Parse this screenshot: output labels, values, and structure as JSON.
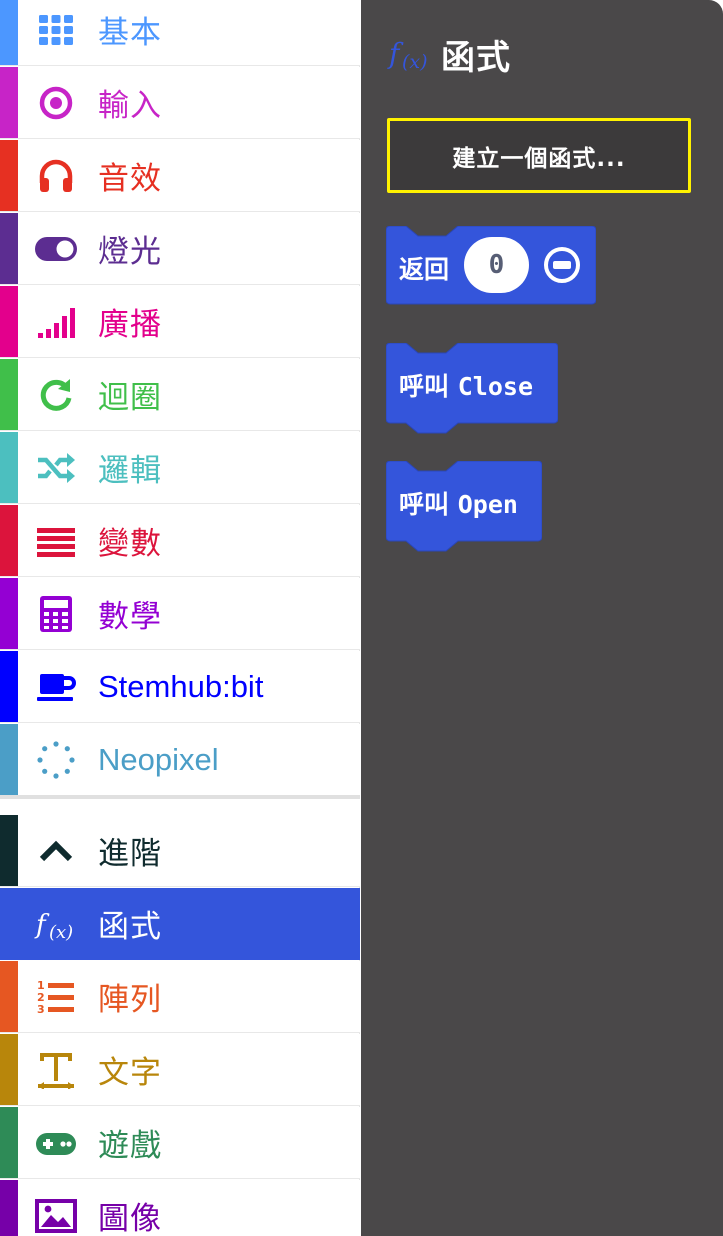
{
  "toolbox": {
    "categories": [
      {
        "label": "基本",
        "color": "#4c97ff",
        "icon": "grid-icon"
      },
      {
        "label": "輸入",
        "color": "#c724c7",
        "icon": "target-icon"
      },
      {
        "label": "音效",
        "color": "#e63022",
        "icon": "headphones-icon"
      },
      {
        "label": "燈光",
        "color": "#5c2d91",
        "icon": "toggle-icon"
      },
      {
        "label": "廣播",
        "color": "#e3008c",
        "icon": "signal-bars-icon"
      },
      {
        "label": "迴圈",
        "color": "#40bf4a",
        "icon": "refresh-icon"
      },
      {
        "label": "邏輯",
        "color": "#4cbfbf",
        "icon": "shuffle-icon"
      },
      {
        "label": "變數",
        "color": "#dc143c",
        "icon": "list-lines-icon"
      },
      {
        "label": "數學",
        "color": "#9400d3",
        "icon": "calculator-icon"
      },
      {
        "label": "Stemhub:bit",
        "color": "#0000ff",
        "icon": "coffee-cup-icon"
      },
      {
        "label": "Neopixel",
        "color": "#4b9ec7",
        "icon": "dotted-circle-icon"
      }
    ],
    "advanced": [
      {
        "label": "進階",
        "color": "#0f2b2e",
        "icon": "chevron-up-icon"
      },
      {
        "label": "函式",
        "color": "#3455db",
        "icon": "function-icon",
        "selected": true
      },
      {
        "label": "陣列",
        "color": "#e65722",
        "icon": "numbered-list-icon"
      },
      {
        "label": "文字",
        "color": "#b8860b",
        "icon": "text-icon"
      },
      {
        "label": "遊戲",
        "color": "#2e8b57",
        "icon": "gamepad-icon"
      },
      {
        "label": "圖像",
        "color": "#7600a8",
        "icon": "image-icon"
      }
    ]
  },
  "flyout": {
    "title": "函式",
    "title_icon": "function-icon",
    "new_function_button": "建立一個函式...",
    "blocks": {
      "return_label": "返回",
      "return_value": "0",
      "call_prefix": "呼叫",
      "call_close_name": "Close",
      "call_open_name": "Open"
    },
    "background_color": "#4a4849",
    "block_color": "#3455db",
    "highlight_color": "#fff200"
  }
}
